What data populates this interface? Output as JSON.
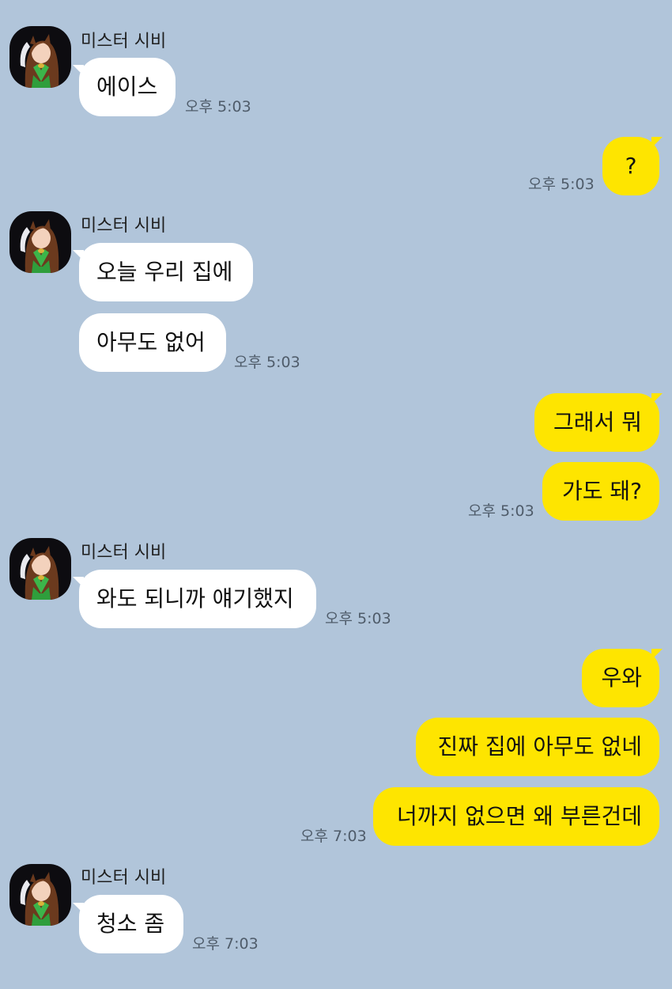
{
  "chat": {
    "sender_name": "미스터 시비",
    "messages": [
      {
        "from": "in",
        "text": "에이스",
        "time": "오후 5:03"
      },
      {
        "from": "out",
        "text": "?",
        "time": "오후 5:03"
      },
      {
        "from": "in",
        "text": "오늘 우리 집에",
        "time": ""
      },
      {
        "from": "in",
        "text": "아무도 없어",
        "time": "오후 5:03"
      },
      {
        "from": "out",
        "text": "그래서 뭐",
        "time": ""
      },
      {
        "from": "out",
        "text": "가도 돼?",
        "time": "오후 5:03"
      },
      {
        "from": "in",
        "text": "와도 되니까 얘기했지",
        "time": "오후 5:03"
      },
      {
        "from": "out",
        "text": "우와",
        "time": ""
      },
      {
        "from": "out",
        "text": "진짜 집에 아무도 없네",
        "time": ""
      },
      {
        "from": "out",
        "text": "너까지 없으면 왜 부른건데",
        "time": "오후 7:03"
      },
      {
        "from": "in",
        "text": "청소 좀",
        "time": "오후 7:03"
      }
    ]
  },
  "colors": {
    "background": "#b1c5da",
    "incoming_bubble": "#ffffff",
    "outgoing_bubble": "#fee500",
    "timestamp": "#4f5c6a"
  },
  "icons": {
    "avatar": "anime-character-avatar"
  }
}
